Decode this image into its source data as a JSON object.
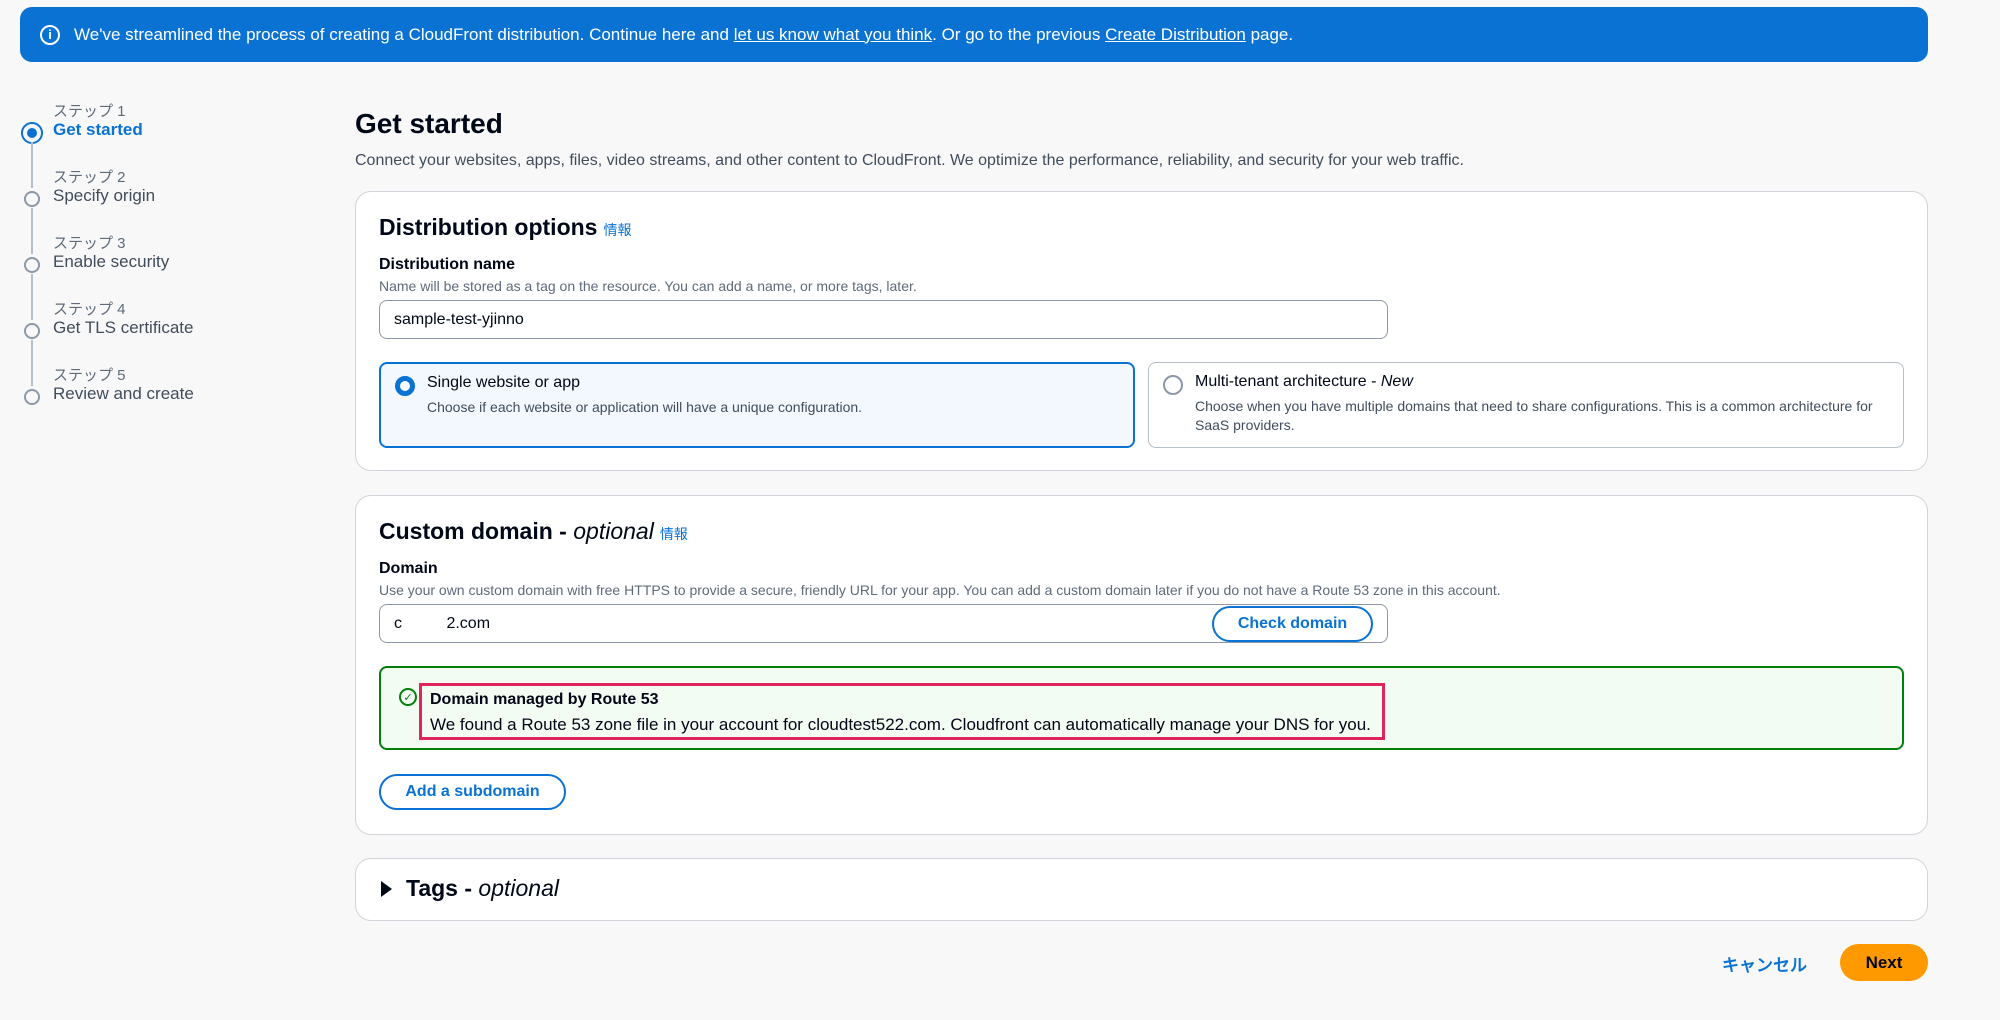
{
  "banner": {
    "text_before": "We've streamlined the process of creating a CloudFront distribution. Continue here and ",
    "link1": "let us know what you think",
    "text_middle": ". Or go to the previous ",
    "link2": "Create Distribution",
    "text_after": " page."
  },
  "steps": [
    {
      "num": "ステップ 1",
      "title": "Get started"
    },
    {
      "num": "ステップ 2",
      "title": "Specify origin"
    },
    {
      "num": "ステップ 3",
      "title": "Enable security"
    },
    {
      "num": "ステップ 4",
      "title": "Get TLS certificate"
    },
    {
      "num": "ステップ 5",
      "title": "Review and create"
    }
  ],
  "main": {
    "title": "Get started",
    "description": "Connect your websites, apps, files, video streams, and other content to CloudFront. We optimize the performance, reliability, and security for your web traffic."
  },
  "distribution_options": {
    "heading": "Distribution options",
    "info": "情報",
    "name_label": "Distribution name",
    "name_desc": "Name will be stored as a tag on the resource. You can add a name, or more tags, later.",
    "name_value": "sample-test-yjinno",
    "tile1_title": "Single website or app",
    "tile1_desc": "Choose if each website or application will have a unique configuration.",
    "tile2_title": "Multi-tenant architecture - ",
    "tile2_title_em": "New",
    "tile2_desc": "Choose when you have multiple domains that need to share configurations. This is a common architecture for SaaS providers."
  },
  "custom_domain": {
    "heading": "Custom domain - ",
    "heading_em": "optional",
    "info": "情報",
    "domain_label": "Domain",
    "domain_desc": "Use your own custom domain with free HTTPS to provide a secure, friendly URL for your app. You can add a custom domain later if you do not have a Route 53 zone in this account.",
    "domain_value": "c          2.com",
    "check_button": "Check domain",
    "success_title": "Domain managed by Route 53",
    "success_text": "We found a Route 53 zone file in your account for cloudtest522.com. Cloudfront can automatically manage your DNS for you.",
    "add_subdomain": "Add a subdomain"
  },
  "tags": {
    "title": "Tags - ",
    "title_em": "optional"
  },
  "footer": {
    "cancel": "キャンセル",
    "next": "Next"
  }
}
